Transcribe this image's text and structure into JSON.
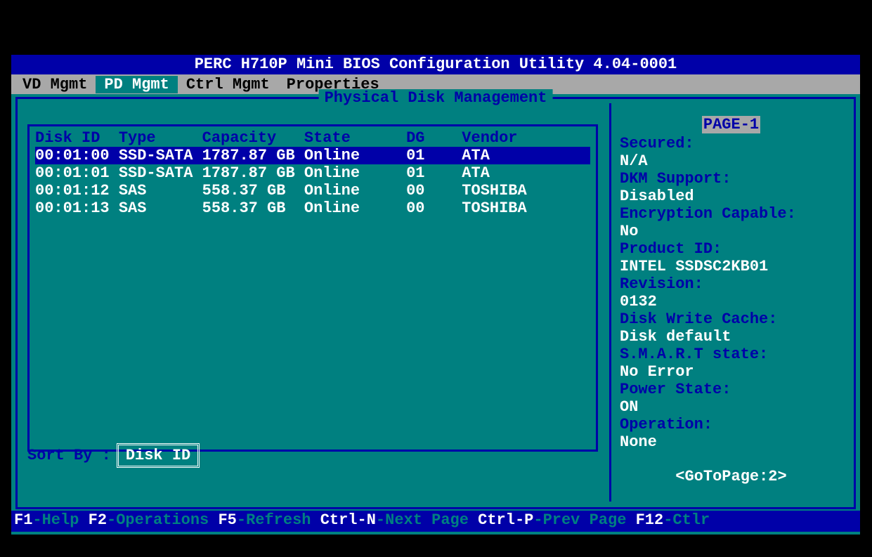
{
  "title": "PERC H710P Mini BIOS Configuration Utility 4.04-0001",
  "menu": {
    "items": [
      "VD Mgmt",
      "PD Mgmt",
      "Ctrl Mgmt",
      "Properties"
    ],
    "active_index": 1
  },
  "panel_title": "Physical Disk Management",
  "table": {
    "headers": {
      "disk_id": "Disk ID",
      "type": "Type",
      "capacity": "Capacity",
      "state": "State",
      "dg": "DG",
      "vendor": "Vendor"
    },
    "rows": [
      {
        "disk_id": "00:01:00",
        "type": "SSD-SATA",
        "capacity": "1787.87 GB",
        "state": "Online",
        "dg": "01",
        "vendor": "ATA",
        "selected": true
      },
      {
        "disk_id": "00:01:01",
        "type": "SSD-SATA",
        "capacity": "1787.87 GB",
        "state": "Online",
        "dg": "01",
        "vendor": "ATA",
        "selected": false
      },
      {
        "disk_id": "00:01:12",
        "type": "SAS",
        "capacity": "558.37 GB",
        "state": "Online",
        "dg": "00",
        "vendor": "TOSHIBA",
        "selected": false
      },
      {
        "disk_id": "00:01:13",
        "type": "SAS",
        "capacity": "558.37 GB",
        "state": "Online",
        "dg": "00",
        "vendor": "TOSHIBA",
        "selected": false
      }
    ]
  },
  "sort": {
    "label": "Sort By :",
    "value": "Disk ID"
  },
  "sidebar": {
    "page_badge": "PAGE-1",
    "fields": [
      {
        "label": "Secured:",
        "value": "N/A"
      },
      {
        "label": "DKM Support:",
        "value": "Disabled"
      },
      {
        "label": "Encryption Capable:",
        "value": "No"
      },
      {
        "label": "Product ID:",
        "value": "INTEL SSDSC2KB01"
      },
      {
        "label": "Revision:",
        "value": "0132"
      },
      {
        "label": "Disk Write Cache:",
        "value": "Disk default"
      },
      {
        "label": "S.M.A.R.T state:",
        "value": "No Error"
      },
      {
        "label": "Power State:",
        "value": "ON"
      },
      {
        "label": "Operation:",
        "value": "None"
      }
    ],
    "goto": "<GoToPage:2>"
  },
  "footer": [
    {
      "key": "F1",
      "label": "-Help "
    },
    {
      "key": "F2",
      "label": "-Operations "
    },
    {
      "key": "F5",
      "label": "-Refresh "
    },
    {
      "key": "Ctrl-N",
      "label": "-Next Page "
    },
    {
      "key": "Ctrl-P",
      "label": "-Prev Page "
    },
    {
      "key": "F12",
      "label": "-Ctlr"
    }
  ]
}
